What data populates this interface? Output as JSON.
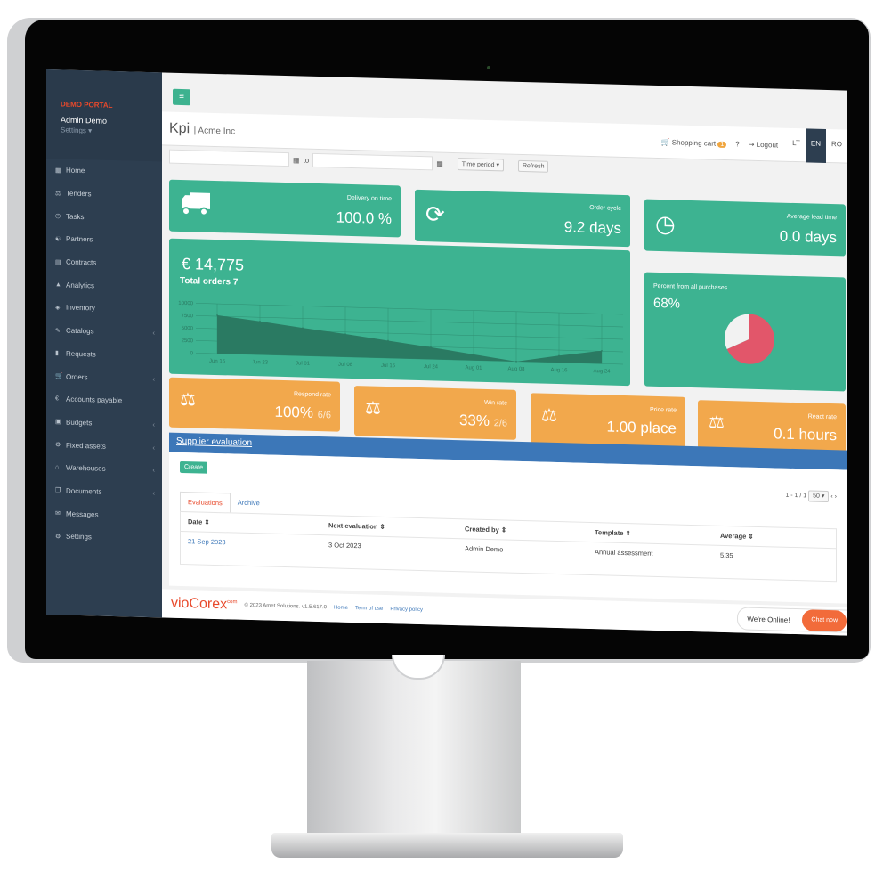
{
  "sidebar": {
    "portal": "DEMO PORTAL",
    "user": "Admin Demo",
    "settings": "Settings ▾",
    "items": [
      {
        "label": "Home",
        "icon": "▦"
      },
      {
        "label": "Tenders",
        "icon": "⚖"
      },
      {
        "label": "Tasks",
        "icon": "◷"
      },
      {
        "label": "Partners",
        "icon": "☯"
      },
      {
        "label": "Contracts",
        "icon": "▤"
      },
      {
        "label": "Analytics",
        "icon": "▲"
      },
      {
        "label": "Inventory",
        "icon": "◈"
      },
      {
        "label": "Catalogs",
        "icon": "✎",
        "sub": "‹"
      },
      {
        "label": "Requests",
        "icon": "▮"
      },
      {
        "label": "Orders",
        "icon": "🛒",
        "sub": "‹"
      },
      {
        "label": "Accounts payable",
        "icon": "€"
      },
      {
        "label": "Budgets",
        "icon": "▣",
        "sub": "‹"
      },
      {
        "label": "Fixed assets",
        "icon": "⚙",
        "sub": "‹"
      },
      {
        "label": "Warehouses",
        "icon": "⌂",
        "sub": "‹"
      },
      {
        "label": "Documents",
        "icon": "❐",
        "sub": "‹"
      },
      {
        "label": "Messages",
        "icon": "✉"
      },
      {
        "label": "Settings",
        "icon": "⚙"
      }
    ]
  },
  "header": {
    "menu_icon": "≡",
    "title": "Kpi",
    "company": "| Acme Inc",
    "cart": "🛒 Shopping cart",
    "cart_count": "1",
    "help": "?",
    "logout": "↪ Logout",
    "langs": [
      "LT",
      "EN",
      "RO"
    ],
    "active_lang": "EN"
  },
  "filters": {
    "to": "to",
    "calendar_icon": "▦",
    "period": "Time period ▾",
    "refresh": "Refresh"
  },
  "kpis": {
    "delivery": {
      "label": "Delivery on time",
      "value": "100.0 %",
      "icon": "truck"
    },
    "cycle": {
      "label": "Order cycle",
      "value": "9.2 days",
      "icon": "refresh"
    },
    "lead": {
      "label": "Average lead time",
      "value": "0.0 days",
      "icon": "clock"
    },
    "total": {
      "amount": "€ 14,775",
      "orders": "Total orders 7"
    },
    "percent": {
      "label": "Percent from all purchases",
      "value": "68%"
    },
    "respond": {
      "label": "Respond rate",
      "value": "100%",
      "sub": "6/6"
    },
    "win": {
      "label": "Win rate",
      "value": "33%",
      "sub": "2/6"
    },
    "price": {
      "label": "Price rate",
      "value": "1.00 place"
    },
    "react": {
      "label": "React rate",
      "value": "0.1 hours"
    }
  },
  "colors": {
    "green": "#3db391",
    "orange": "#f2a84c",
    "blue": "#3c77b8",
    "sidebar": "#2d3e50",
    "pie_red": "#e2566a"
  },
  "chart_data": [
    {
      "type": "area",
      "x": [
        "Jun 16",
        "Jun 23",
        "Jul 01",
        "Jul 08",
        "Jul 16",
        "Jul 24",
        "Aug 01",
        "Aug 08",
        "Aug 16",
        "Aug 24"
      ],
      "values": [
        7700,
        6700,
        5600,
        4600,
        3500,
        2400,
        1200,
        0,
        1400,
        2600
      ],
      "yticks": [
        0,
        2500,
        5000,
        7500,
        10000
      ],
      "ylim": [
        0,
        10000
      ],
      "grid": true
    },
    {
      "type": "pie",
      "values": [
        68,
        32
      ],
      "colors": [
        "#e2566a",
        "#f2f2f2"
      ]
    }
  ],
  "evaluation": {
    "title": "Supplier evaluation",
    "create": "Create",
    "pager": "1 - 1 / 1",
    "page_size": "50 ▾",
    "tabs": [
      "Evaluations",
      "Archive"
    ],
    "columns": [
      "Date ⇕",
      "Next evaluation ⇕",
      "Created by ⇕",
      "Template ⇕",
      "Average ⇕"
    ],
    "rows": [
      [
        "21 Sep 2023",
        "3 Oct 2023",
        "Admin Demo",
        "Annual assessment",
        "5.35"
      ]
    ]
  },
  "footer": {
    "logo": "vioCorex",
    "logo_sup": "com",
    "copyright": "© 2023 Amet Solutions. v1.5.617.0",
    "links": [
      "Home",
      "Term of use",
      "Privacy policy"
    ],
    "online": "We're Online!",
    "chat": "Chat now"
  }
}
